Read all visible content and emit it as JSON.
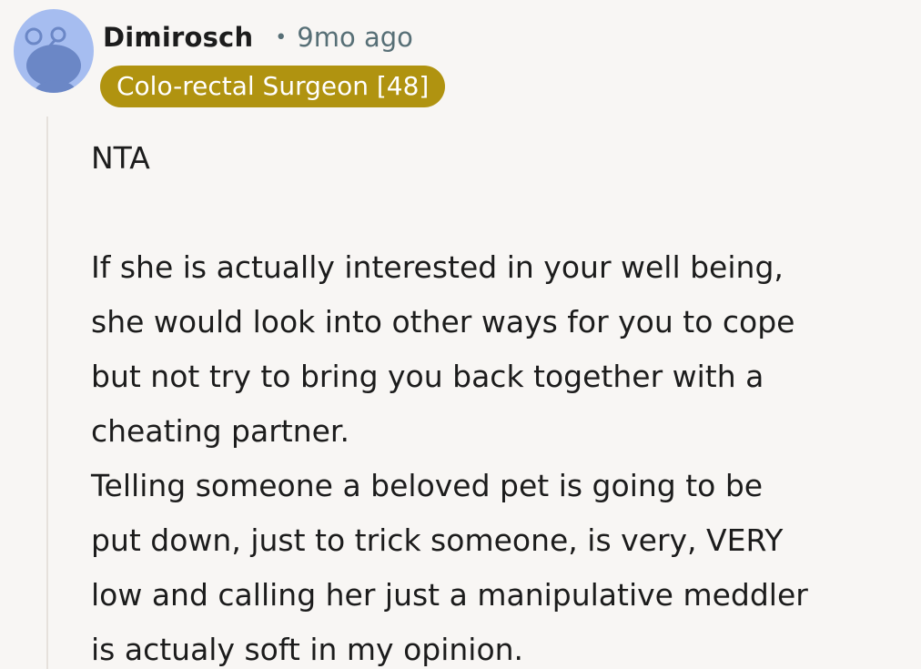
{
  "comment": {
    "author": "Dimirosch",
    "separator": "•",
    "timestamp": "9mo ago",
    "flair": "Colo-rectal Surgeon [48]",
    "avatar_icon": "reddit-snoo-avatar-icon",
    "flair_color": "#b09310",
    "avatar_color": "#a6bdf0",
    "body": {
      "line1": "NTA",
      "paragraph2": "If she is actually interested in your well being,\nshe would look into other ways for you to cope\nbut not try to bring you back together with a\ncheating partner.",
      "paragraph3": "Telling someone a beloved pet is going to be\nput down, just to trick someone, is very, VERY\nlow and calling her just a manipulative meddler\nis actualy soft in my opinion."
    }
  }
}
